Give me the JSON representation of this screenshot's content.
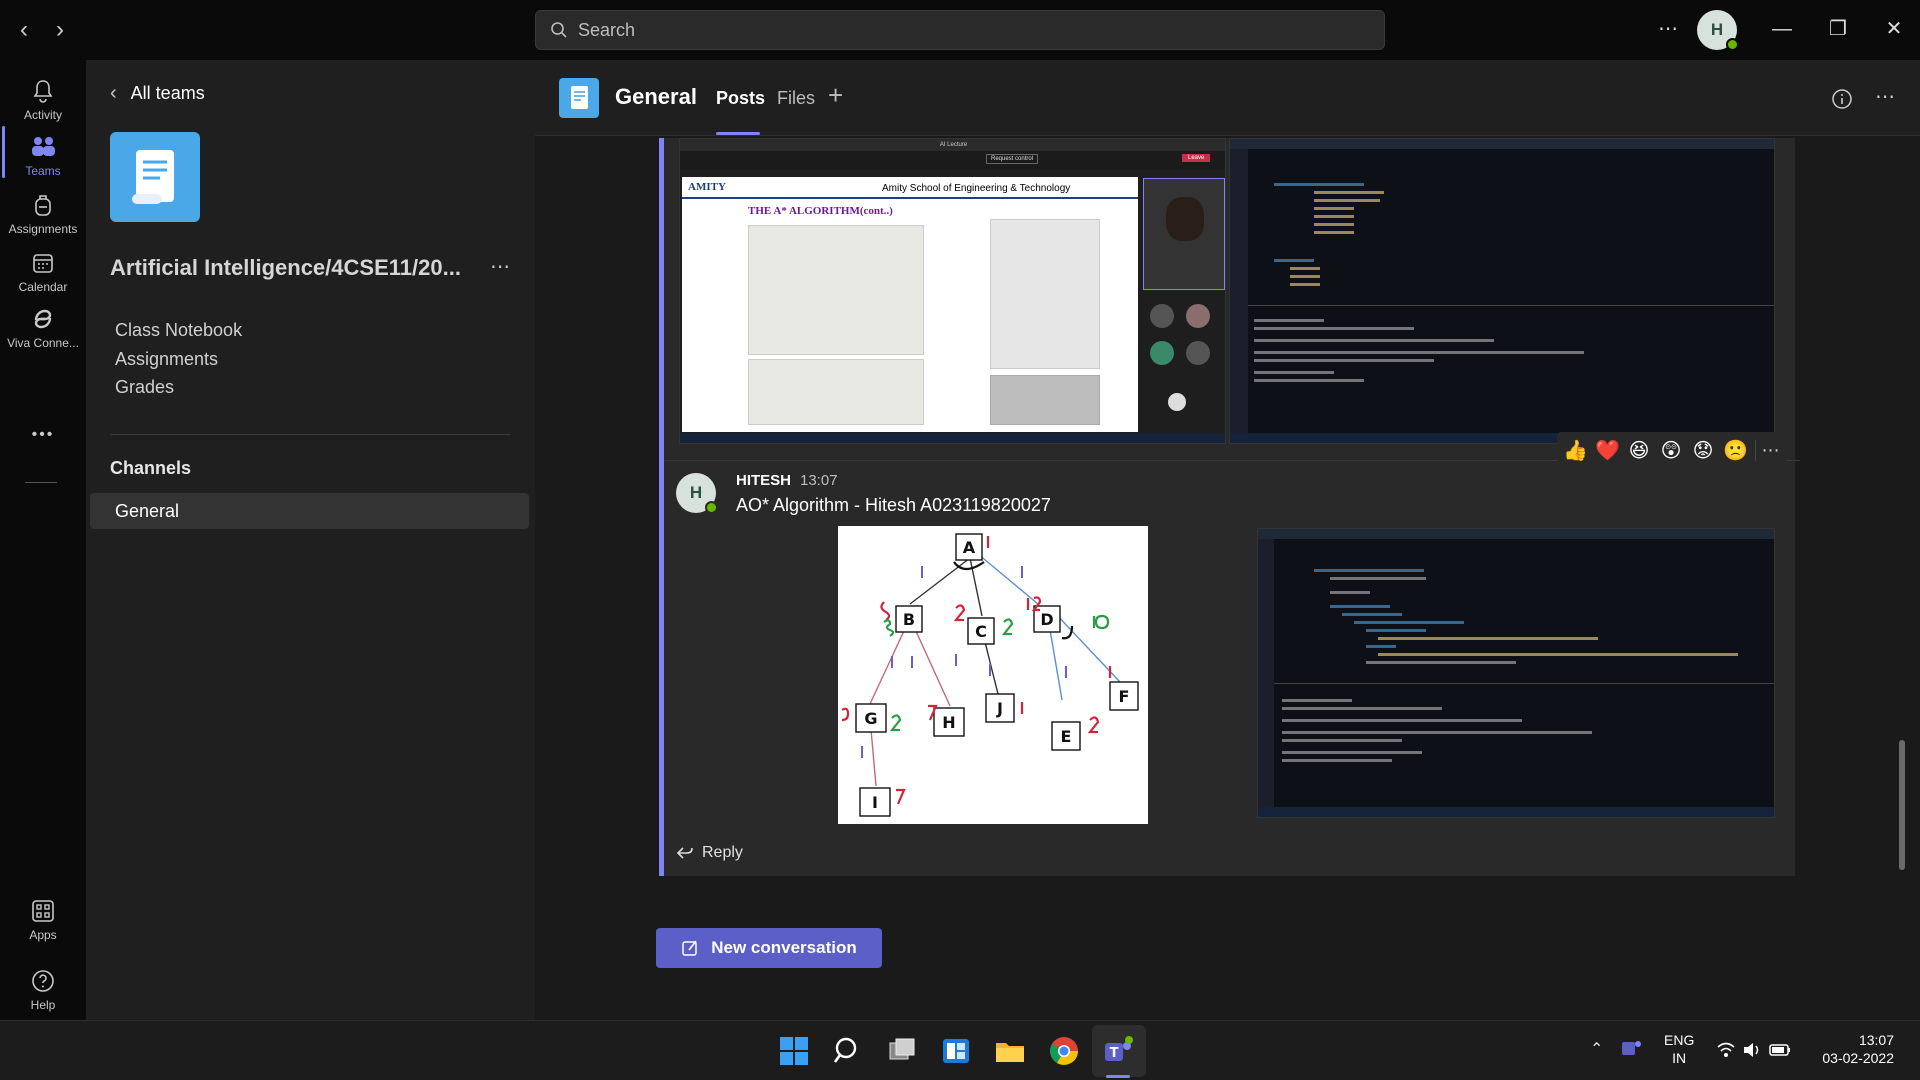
{
  "titlebar": {
    "search_placeholder": "Search",
    "avatar_initial": "H",
    "more_label": "⋯",
    "minimize": "—",
    "maximize": "❐",
    "close": "✕"
  },
  "rail": {
    "items": [
      {
        "label": "Activity",
        "icon": "bell-icon"
      },
      {
        "label": "Teams",
        "icon": "teams-icon",
        "active": true
      },
      {
        "label": "Assignments",
        "icon": "backpack-icon"
      },
      {
        "label": "Calendar",
        "icon": "calendar-icon"
      },
      {
        "label": "Viva Conne...",
        "icon": "viva-icon"
      },
      {
        "label": "•••",
        "icon": "more-icon"
      }
    ],
    "bottom": [
      {
        "label": "Apps",
        "icon": "apps-icon"
      },
      {
        "label": "Help",
        "icon": "help-icon"
      }
    ]
  },
  "team_panel": {
    "back_label": "All teams",
    "team_name": "Artificial Intelligence/4CSE11/20...",
    "links": [
      "Class Notebook",
      "Assignments",
      "Grades"
    ],
    "channels_heading": "Channels",
    "channels": [
      "General"
    ]
  },
  "channel": {
    "title": "General",
    "tabs": [
      "Posts",
      "Files"
    ],
    "active_tab": "Posts"
  },
  "previous_post": {
    "left_screenshot": {
      "window_title": "AI Lecture",
      "request_control": "Request control",
      "leave": "Leave",
      "org": "AMITY",
      "school": "Amity School of Engineering & Technology",
      "slide_title": "THE A* ALGORITHM(cont..)"
    },
    "reactions": [
      "👍",
      "❤️",
      "😆",
      "😲",
      "😟",
      "🙁"
    ]
  },
  "message": {
    "avatar_initial": "H",
    "author": "HITESH",
    "time": "13:07",
    "text": "AO* Algorithm - Hitesh A023119820027",
    "diagram_nodes": [
      "A",
      "B",
      "C",
      "D",
      "G",
      "H",
      "J",
      "E",
      "F",
      "I"
    ],
    "reply_label": "Reply"
  },
  "new_conversation_label": "New conversation",
  "taskbar": {
    "lang_top": "ENG",
    "lang_bottom": "IN",
    "time": "13:07",
    "date": "03-02-2022"
  },
  "colors": {
    "accent": "#7f85f5",
    "button": "#5b5fc7",
    "team_logo": "#4aa8e8"
  }
}
